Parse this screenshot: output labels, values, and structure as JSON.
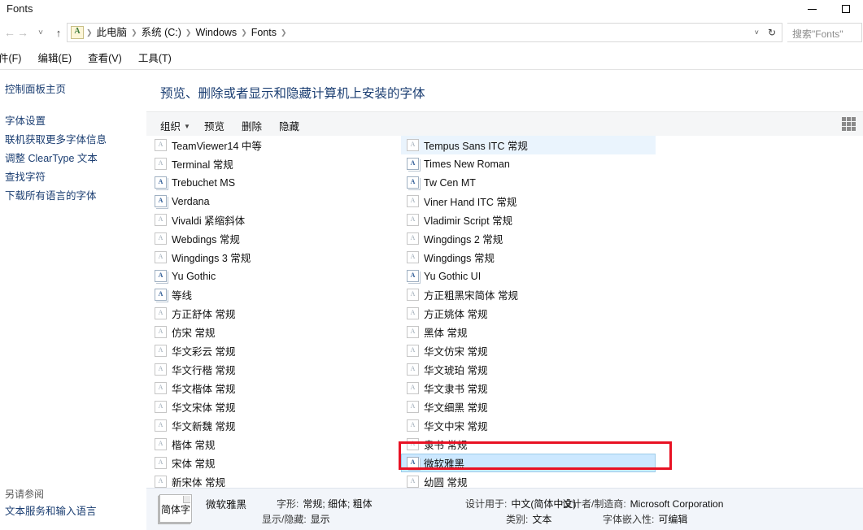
{
  "window": {
    "title": "Fonts",
    "controls": [
      {
        "name": "minimize",
        "glyph": "—"
      },
      {
        "name": "maximize",
        "glyph": "□"
      }
    ]
  },
  "addressbar": {
    "back_glyph": "←",
    "forward_glyph": "→",
    "recent_glyph": "˅",
    "up_glyph": "↑",
    "icon_letter": "A",
    "crumbs": [
      "此电脑",
      "系统 (C:)",
      "Windows",
      "Fonts"
    ],
    "separator": "❯",
    "dropdown_glyph": "˅",
    "refresh_glyph": "↻"
  },
  "search": {
    "placeholder": "搜索\"Fonts\""
  },
  "menubar": {
    "items": [
      "件(F)",
      "编辑(E)",
      "查看(V)",
      "工具(T)"
    ]
  },
  "sidebar": {
    "home": "控制面板主页",
    "links": [
      "字体设置",
      "联机获取更多字体信息",
      "调整 ClearType 文本",
      "查找字符",
      "下载所有语言的字体"
    ],
    "see_also_title": "另请参阅",
    "see_also_links": [
      "文本服务和输入语言"
    ]
  },
  "content": {
    "heading": "预览、删除或者显示和隐藏计算机上安装的字体",
    "toolbar": {
      "organize": "组织",
      "organize_caret": "▼",
      "preview": "预览",
      "delete": "删除",
      "hide": "隐藏",
      "view_icon": "grid-view-icon"
    }
  },
  "font_list": {
    "left_column": [
      {
        "label": "TeamViewer14 中等",
        "icon": "font-file-icon",
        "state": "normal"
      },
      {
        "label": "Terminal 常规",
        "icon": "font-file-icon",
        "state": "normal"
      },
      {
        "label": "Trebuchet MS",
        "icon": "font-family-icon",
        "state": "normal"
      },
      {
        "label": "Verdana",
        "icon": "font-family-icon",
        "state": "normal"
      },
      {
        "label": "Vivaldi 紧缩斜体",
        "icon": "font-file-icon",
        "state": "normal"
      },
      {
        "label": "Webdings 常规",
        "icon": "font-file-icon",
        "state": "normal"
      },
      {
        "label": "Wingdings 3 常规",
        "icon": "font-file-icon",
        "state": "normal"
      },
      {
        "label": "Yu Gothic",
        "icon": "font-family-icon",
        "state": "normal"
      },
      {
        "label": "等线",
        "icon": "font-family-icon",
        "state": "normal"
      },
      {
        "label": "方正舒体 常规",
        "icon": "font-file-icon",
        "state": "normal"
      },
      {
        "label": "仿宋 常规",
        "icon": "font-file-icon",
        "state": "normal"
      },
      {
        "label": "华文彩云 常规",
        "icon": "font-file-icon",
        "state": "normal"
      },
      {
        "label": "华文行楷 常规",
        "icon": "font-file-icon",
        "state": "normal"
      },
      {
        "label": "华文楷体 常规",
        "icon": "font-file-icon",
        "state": "normal"
      },
      {
        "label": "华文宋体 常规",
        "icon": "font-file-icon",
        "state": "normal"
      },
      {
        "label": "华文新魏 常规",
        "icon": "font-file-icon",
        "state": "normal"
      },
      {
        "label": "楷体 常规",
        "icon": "font-file-icon",
        "state": "normal"
      },
      {
        "label": "宋体 常规",
        "icon": "font-file-icon",
        "state": "normal"
      },
      {
        "label": "新宋体 常规",
        "icon": "font-file-icon",
        "state": "normal"
      }
    ],
    "right_column": [
      {
        "label": "Tempus Sans ITC 常规",
        "icon": "font-file-icon",
        "state": "hovered"
      },
      {
        "label": "Times New Roman",
        "icon": "font-family-icon",
        "state": "normal"
      },
      {
        "label": "Tw Cen MT",
        "icon": "font-family-icon",
        "state": "normal"
      },
      {
        "label": "Viner Hand ITC 常规",
        "icon": "font-file-icon",
        "state": "normal"
      },
      {
        "label": "Vladimir Script 常规",
        "icon": "font-file-icon",
        "state": "normal"
      },
      {
        "label": "Wingdings 2 常规",
        "icon": "font-file-icon",
        "state": "normal"
      },
      {
        "label": "Wingdings 常规",
        "icon": "font-file-icon",
        "state": "normal"
      },
      {
        "label": "Yu Gothic UI",
        "icon": "font-family-icon",
        "state": "normal"
      },
      {
        "label": "方正粗黑宋简体 常规",
        "icon": "font-file-icon",
        "state": "normal"
      },
      {
        "label": "方正姚体 常规",
        "icon": "font-file-icon",
        "state": "normal"
      },
      {
        "label": "黑体 常规",
        "icon": "font-file-icon",
        "state": "normal"
      },
      {
        "label": "华文仿宋 常规",
        "icon": "font-file-icon",
        "state": "normal"
      },
      {
        "label": "华文琥珀 常规",
        "icon": "font-file-icon",
        "state": "normal"
      },
      {
        "label": "华文隶书 常规",
        "icon": "font-file-icon",
        "state": "normal"
      },
      {
        "label": "华文细黑 常规",
        "icon": "font-file-icon",
        "state": "normal"
      },
      {
        "label": "华文中宋 常规",
        "icon": "font-file-icon",
        "state": "normal"
      },
      {
        "label": "隶书 常规",
        "icon": "font-file-icon",
        "state": "normal"
      },
      {
        "label": "微软雅黑",
        "icon": "font-family-icon",
        "state": "selected"
      },
      {
        "label": "幼圆 常规",
        "icon": "font-file-icon",
        "state": "normal"
      }
    ]
  },
  "annotation": {
    "color": "#e81123",
    "shape": "rectangle"
  },
  "details": {
    "icon_text": "简体字",
    "font_name": "微软雅黑",
    "fields": [
      {
        "key": "字形:",
        "value": "常规; 细体; 粗体"
      },
      {
        "key": "显示/隐藏:",
        "value": "显示"
      },
      {
        "key": "设计用于:",
        "value": "中文(简体中文)"
      },
      {
        "key": "类别:",
        "value": "文本"
      },
      {
        "key": "设计者/制造商:",
        "value": "Microsoft Corporation"
      },
      {
        "key": "字体嵌入性:",
        "value": "可编辑"
      }
    ]
  }
}
